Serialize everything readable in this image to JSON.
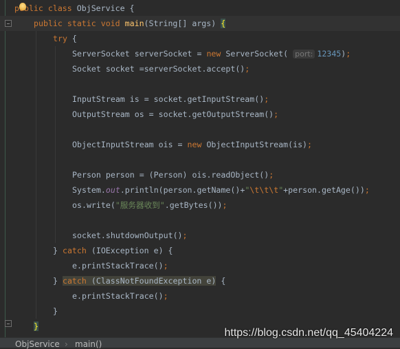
{
  "code": {
    "lines": [
      {
        "indent": 0,
        "tokens": [
          {
            "c": "k",
            "t": "public class "
          },
          {
            "c": "t",
            "t": "ObjService {"
          }
        ]
      },
      {
        "indent": 1,
        "current": true,
        "tokens": [
          {
            "c": "k",
            "t": "public static void "
          },
          {
            "c": "f",
            "t": "main"
          },
          {
            "c": "t",
            "t": "(String[] args) "
          },
          {
            "c": "brace-hl",
            "t": "{"
          }
        ]
      },
      {
        "indent": 2,
        "tokens": [
          {
            "c": "k",
            "t": "try "
          },
          {
            "c": "t",
            "t": "{"
          }
        ]
      },
      {
        "indent": 3,
        "tokens": [
          {
            "c": "t",
            "t": "ServerSocket serverSocket = "
          },
          {
            "c": "k",
            "t": "new "
          },
          {
            "c": "t",
            "t": "ServerSocket( "
          },
          {
            "c": "h",
            "t": "port:"
          },
          {
            "c": "n",
            "t": "12345"
          },
          {
            "c": "t",
            "t": ")"
          },
          {
            "c": "p",
            "t": ";"
          }
        ]
      },
      {
        "indent": 3,
        "tokens": [
          {
            "c": "t",
            "t": "Socket socket =serverSocket.accept()"
          },
          {
            "c": "p",
            "t": ";"
          }
        ]
      },
      {
        "indent": 3,
        "tokens": []
      },
      {
        "indent": 3,
        "tokens": [
          {
            "c": "t",
            "t": "InputStream is = socket.getInputStream()"
          },
          {
            "c": "p",
            "t": ";"
          }
        ]
      },
      {
        "indent": 3,
        "tokens": [
          {
            "c": "t",
            "t": "OutputStream os = socket.getOutputStream()"
          },
          {
            "c": "p",
            "t": ";"
          }
        ]
      },
      {
        "indent": 3,
        "tokens": []
      },
      {
        "indent": 3,
        "tokens": [
          {
            "c": "t",
            "t": "ObjectInputStream ois = "
          },
          {
            "c": "k",
            "t": "new "
          },
          {
            "c": "t",
            "t": "ObjectInputStream(is)"
          },
          {
            "c": "p",
            "t": ";"
          }
        ]
      },
      {
        "indent": 3,
        "tokens": []
      },
      {
        "indent": 3,
        "tokens": [
          {
            "c": "t",
            "t": "Person person = (Person) ois.readObject()"
          },
          {
            "c": "p",
            "t": ";"
          }
        ]
      },
      {
        "indent": 3,
        "tokens": [
          {
            "c": "t",
            "t": "System."
          },
          {
            "c": "i",
            "t": "out"
          },
          {
            "c": "t",
            "t": ".println(person.getName()+"
          },
          {
            "c": "s",
            "t": "\""
          },
          {
            "c": "e",
            "t": "\\t\\t\\t"
          },
          {
            "c": "s",
            "t": "\""
          },
          {
            "c": "t",
            "t": "+person.getAge())"
          },
          {
            "c": "p",
            "t": ";"
          }
        ]
      },
      {
        "indent": 3,
        "tokens": [
          {
            "c": "t",
            "t": "os.write("
          },
          {
            "c": "s",
            "t": "\"服务器收到\""
          },
          {
            "c": "t",
            "t": ".getBytes())"
          },
          {
            "c": "p",
            "t": ";"
          }
        ]
      },
      {
        "indent": 3,
        "tokens": []
      },
      {
        "indent": 3,
        "tokens": [
          {
            "c": "t",
            "t": "socket.shutdownOutput()"
          },
          {
            "c": "p",
            "t": ";"
          }
        ]
      },
      {
        "indent": 2,
        "tokens": [
          {
            "c": "t",
            "t": "} "
          },
          {
            "c": "k",
            "t": "catch "
          },
          {
            "c": "t",
            "t": "(IOException e) {"
          }
        ]
      },
      {
        "indent": 3,
        "tokens": [
          {
            "c": "t",
            "t": "e.printStackTrace()"
          },
          {
            "c": "p",
            "t": ";"
          }
        ]
      },
      {
        "indent": 2,
        "tokens": [
          {
            "c": "t",
            "t": "} "
          },
          {
            "c": "k hl",
            "t": "catch "
          },
          {
            "c": "t hl",
            "t": "(ClassNotFoundException e)"
          },
          {
            "c": "t",
            "t": " {"
          }
        ]
      },
      {
        "indent": 3,
        "tokens": [
          {
            "c": "t",
            "t": "e.printStackTrace()"
          },
          {
            "c": "p",
            "t": ";"
          }
        ]
      },
      {
        "indent": 2,
        "tokens": [
          {
            "c": "t",
            "t": "}"
          }
        ]
      },
      {
        "indent": 1,
        "tokens": [
          {
            "c": "brace-hl",
            "t": "}"
          }
        ]
      }
    ]
  },
  "breadcrumb": {
    "items": [
      "ObjService",
      "main()"
    ],
    "separator": "›"
  },
  "watermark": "https://blog.csdn.net/qq_45404224",
  "colors": {
    "background": "#2b2b2b",
    "keyword": "#cc7832",
    "text": "#a9b7c6",
    "string": "#6a8759",
    "function": "#ffc66d",
    "number": "#6897bb"
  }
}
